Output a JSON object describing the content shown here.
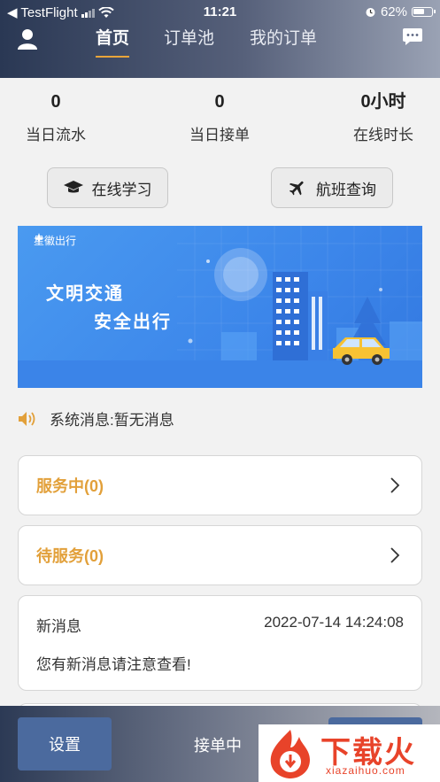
{
  "status_bar": {
    "carrier": "◀ TestFlight",
    "time": "11:21",
    "battery": "62%",
    "battery_level": 0.62
  },
  "nav": {
    "tabs": [
      {
        "label": "首页"
      },
      {
        "label": "订单池"
      },
      {
        "label": "我的订单"
      }
    ],
    "active_tab": 0
  },
  "stats": [
    {
      "value": "0",
      "label": "当日流水"
    },
    {
      "value": "0",
      "label": "当日接单"
    },
    {
      "value": "0小时",
      "label": "在线时长"
    }
  ],
  "quick_actions": {
    "study": "在线学习",
    "flight": "航班查询"
  },
  "banner": {
    "brand": "星徽出行",
    "slogan_line1": "文明交通",
    "slogan_line2": "安全出行"
  },
  "notice": {
    "text": "系统消息:暂无消息"
  },
  "orders": {
    "in_service": "服务中(0)",
    "pending": "待服务(0)"
  },
  "message": {
    "title": "新消息",
    "timestamp": "2022-07-14 14:24:08",
    "body": "您有新消息请注意查看!"
  },
  "bottom_bar": {
    "settings": "设置",
    "status": "接单中"
  },
  "watermark": {
    "text": "下载火",
    "sub": "xiazaihuo.com"
  },
  "colors": {
    "accent": "#e2a03a",
    "button_blue": "#4b6a9e",
    "banner_blue": "#3c86ea"
  }
}
